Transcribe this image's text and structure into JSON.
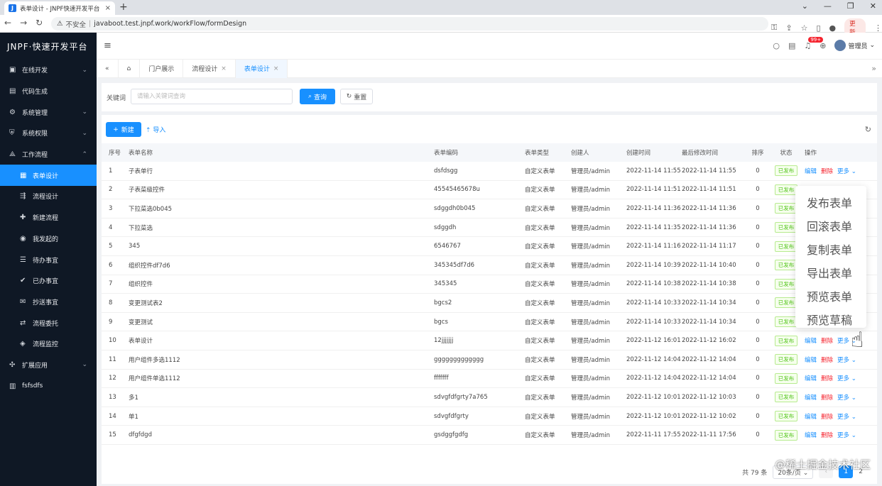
{
  "browser": {
    "tab_title": "表单设计 - JNPF快速开发平台",
    "url_insecure": "不安全",
    "url": "javaboot.test.jnpf.work/workFlow/formDesign",
    "update_label": "更新"
  },
  "sidebar": {
    "logo": "JNPF·快速开发平台",
    "items": [
      {
        "label": "在线开发",
        "icon": "monitor-icon",
        "arrow": "⌄"
      },
      {
        "label": "代码生成",
        "icon": "code-icon",
        "arrow": ""
      },
      {
        "label": "系统管理",
        "icon": "gear-icon",
        "arrow": "⌄"
      },
      {
        "label": "系统权限",
        "icon": "shield-icon",
        "arrow": "⌄"
      },
      {
        "label": "工作流程",
        "icon": "workflow-icon",
        "arrow": "⌃"
      },
      {
        "label": "表单设计",
        "icon": "form-icon",
        "arrow": "",
        "sub": true,
        "active": true
      },
      {
        "label": "流程设计",
        "icon": "flow-icon",
        "arrow": "",
        "sub": true
      },
      {
        "label": "新建流程",
        "icon": "new-icon",
        "arrow": "",
        "sub": true
      },
      {
        "label": "我发起的",
        "icon": "user-icon",
        "arrow": "",
        "sub": true
      },
      {
        "label": "待办事宜",
        "icon": "todo-icon",
        "arrow": "",
        "sub": true
      },
      {
        "label": "已办事宜",
        "icon": "done-icon",
        "arrow": "",
        "sub": true
      },
      {
        "label": "抄送事宜",
        "icon": "cc-icon",
        "arrow": "",
        "sub": true
      },
      {
        "label": "流程委托",
        "icon": "delegate-icon",
        "arrow": "",
        "sub": true
      },
      {
        "label": "流程监控",
        "icon": "monitor-flow-icon",
        "arrow": "",
        "sub": true
      },
      {
        "label": "扩展应用",
        "icon": "extend-icon",
        "arrow": "⌄"
      },
      {
        "label": "fsfsdfs",
        "icon": "doc-icon",
        "arrow": ""
      }
    ]
  },
  "topbar": {
    "badge": "99+",
    "user": "管理员"
  },
  "tabs": [
    {
      "label": "门户展示",
      "closable": false
    },
    {
      "label": "流程设计",
      "closable": true
    },
    {
      "label": "表单设计",
      "closable": true,
      "active": true
    }
  ],
  "search": {
    "label": "关键词",
    "placeholder": "请输入关键词查询",
    "query_btn": "查询",
    "reset_btn": "重置"
  },
  "toolbar": {
    "new_btn": "新建",
    "import_btn": "导入"
  },
  "table": {
    "headers": [
      "序号",
      "表单名称",
      "表单编码",
      "表单类型",
      "创建人",
      "创建时间",
      "最后修改时间",
      "排序",
      "状态",
      "操作"
    ],
    "action_edit": "编辑",
    "action_delete": "删除",
    "action_more": "更多",
    "rows": [
      [
        "1",
        "子表单行",
        "dsfdsgg",
        "自定义表单",
        "管理员/admin",
        "2022-11-14 11:55",
        "2022-11-14 11:55",
        "0",
        "已发布"
      ],
      [
        "2",
        "子表菜级控件",
        "45545465678u",
        "自定义表单",
        "管理员/admin",
        "2022-11-14 11:51",
        "2022-11-14 11:51",
        "0",
        "已发布"
      ],
      [
        "3",
        "下拉菜选0b045",
        "sdggdh0b045",
        "自定义表单",
        "管理员/admin",
        "2022-11-14 11:36",
        "2022-11-14 11:36",
        "0",
        "已发布"
      ],
      [
        "4",
        "下拉菜选",
        "sdggdh",
        "自定义表单",
        "管理员/admin",
        "2022-11-14 11:35",
        "2022-11-14 11:36",
        "0",
        "已发布"
      ],
      [
        "5",
        "345",
        "6546767",
        "自定义表单",
        "管理员/admin",
        "2022-11-14 11:16",
        "2022-11-14 11:17",
        "0",
        "已发布"
      ],
      [
        "6",
        "组织控件df7d6",
        "345345df7d6",
        "自定义表单",
        "管理员/admin",
        "2022-11-14 10:39",
        "2022-11-14 10:40",
        "0",
        "已发布"
      ],
      [
        "7",
        "组织控件",
        "345345",
        "自定义表单",
        "管理员/admin",
        "2022-11-14 10:38",
        "2022-11-14 10:38",
        "0",
        "已发布"
      ],
      [
        "8",
        "变更测试表2",
        "bgcs2",
        "自定义表单",
        "管理员/admin",
        "2022-11-14 10:33",
        "2022-11-14 10:34",
        "0",
        "已发布"
      ],
      [
        "9",
        "变更测试",
        "bgcs",
        "自定义表单",
        "管理员/admin",
        "2022-11-14 10:33",
        "2022-11-14 10:34",
        "0",
        "已发布"
      ],
      [
        "10",
        "表单设计",
        "12jjjjjjj",
        "自定义表单",
        "管理员/admin",
        "2022-11-12 16:01",
        "2022-11-12 16:02",
        "0",
        "已发布"
      ],
      [
        "11",
        "用户组件多选1112",
        "ggggggggggggg",
        "自定义表单",
        "管理员/admin",
        "2022-11-12 14:04",
        "2022-11-12 14:04",
        "0",
        "已发布"
      ],
      [
        "12",
        "用户组件单选1112",
        "fffffff",
        "自定义表单",
        "管理员/admin",
        "2022-11-12 14:04",
        "2022-11-12 14:04",
        "0",
        "已发布"
      ],
      [
        "13",
        "多1",
        "sdvgfdfgrty7a765",
        "自定义表单",
        "管理员/admin",
        "2022-11-12 10:01",
        "2022-11-12 10:03",
        "0",
        "已发布"
      ],
      [
        "14",
        "单1",
        "sdvgfdfgrty",
        "自定义表单",
        "管理员/admin",
        "2022-11-12 10:01",
        "2022-11-12 10:02",
        "0",
        "已发布"
      ],
      [
        "15",
        "dfgfdgd",
        "gsdggfgdfg",
        "自定义表单",
        "管理员/admin",
        "2022-11-11 17:55",
        "2022-11-11 17:56",
        "0",
        "已发布"
      ]
    ]
  },
  "pager": {
    "total": "共 79 条",
    "page_size": "20条/页",
    "current": "1",
    "next": "2"
  },
  "dropdown": [
    "发布表单",
    "回滚表单",
    "复制表单",
    "导出表单",
    "预览表单",
    "预览草稿"
  ],
  "watermark": "@稀土掘金技术社区"
}
